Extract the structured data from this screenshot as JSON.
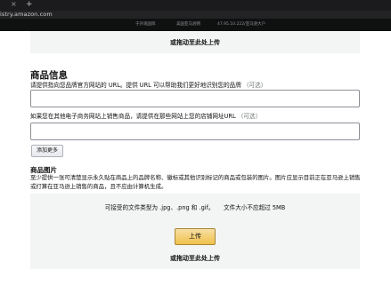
{
  "browser": {
    "tab_close": "×",
    "new_tab": "+",
    "url": "istry.amazon.com"
  },
  "header": {
    "items": [
      "于外观国际",
      "美国亚马逊网",
      "47.95.10.222/亚马逊大户"
    ]
  },
  "top_dropzone": {
    "drag_text": "或拖动至此处上传"
  },
  "product_info": {
    "title": "商品信息",
    "brand_url_label": "请提供指向您品牌官方网站的 URL。提供 URL 可以帮助我们更好地识别您的品牌",
    "brand_url_optional": "（可选）",
    "brand_url_value": "",
    "store_url_label": "如果您在其他电子商务网站上销售商品，请提供在那些网站上您的店铺网址URL",
    "store_url_optional": "（可选）",
    "store_url_value": "",
    "add_more_label": "添加更多"
  },
  "product_images": {
    "title": "商品图片",
    "description": "至少提供一张可清楚显示永久贴在商品上的品牌名称、徽标或其他识别标记的商品或包装的图片。图片应显示目前正在亚马逊上销售或打算在亚马逊上销售的商品，且不应由计算机生成。",
    "file_types": "可接受的文件类型为 .jpg、.png 和 .gif。     文件大小不应超过 5MB",
    "upload_label": "上传",
    "drag_text": "或拖动至此处上传"
  },
  "colors": {
    "header_bg": "#0f1111",
    "dropzone_bg": "#f3f4f4",
    "upload_button": "#f0c14b"
  }
}
